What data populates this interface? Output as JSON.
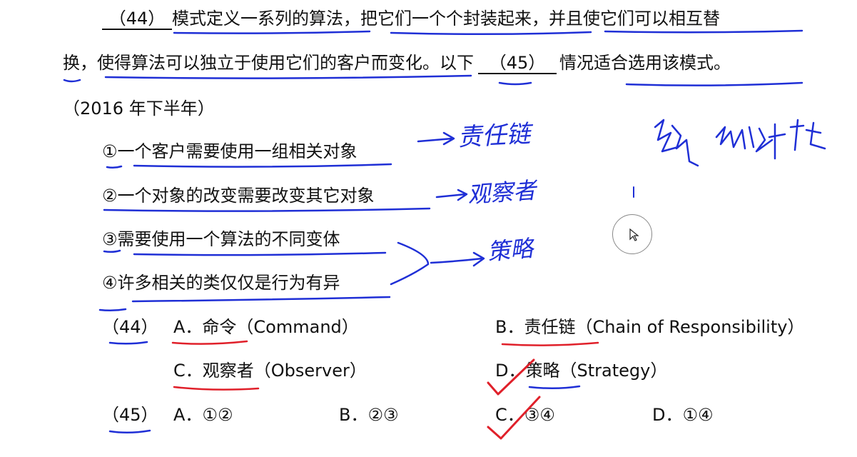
{
  "question": {
    "blank_44": "（44）",
    "line1_text": "模式定义一系列的算法，把它们一个个封装起来，并且使它们可以相互替",
    "line2_text_a": "换，使得算法可以独立于使用它们的客户而变化。以下",
    "blank_45": "（45）",
    "line2_text_b": "情况适合选用该模式。",
    "source": "（2016 年下半年）"
  },
  "conditions": [
    "①一个客户需要使用一组相关对象",
    "②一个对象的改变需要改变其它对象",
    "③需要使用一个算法的不同变体",
    "④许多相关的类仅仅是行为有异"
  ],
  "q44": {
    "number": "（44）",
    "options": [
      {
        "letter": "A．",
        "text": "命令（Command）"
      },
      {
        "letter": "B．",
        "text": "责任链（Chain of Responsibility）"
      },
      {
        "letter": "C．",
        "text": "观察者（Observer）"
      },
      {
        "letter": "D．",
        "text": "策略（Strategy）"
      }
    ]
  },
  "q45": {
    "number": "（45）",
    "options": [
      {
        "letter": "A．",
        "text": "①②"
      },
      {
        "letter": "B．",
        "text": "②③"
      },
      {
        "letter": "C．",
        "text": "③④"
      },
      {
        "letter": "D．",
        "text": "①④"
      }
    ]
  },
  "annotations": {
    "note_1": "责任链",
    "note_2": "观察者",
    "note_3": "策略"
  },
  "colors": {
    "ink_blue": "#1f2fd6",
    "ink_red": "#e0202a",
    "text": "#111111"
  }
}
